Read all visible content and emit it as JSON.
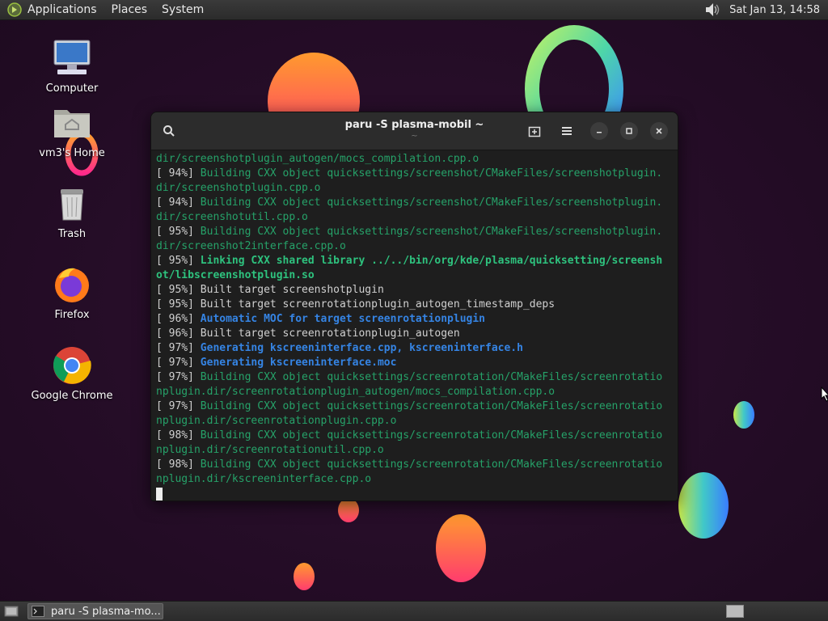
{
  "top_panel": {
    "menus": [
      "Applications",
      "Places",
      "System"
    ],
    "clock": "Sat Jan 13, 14:58"
  },
  "desktop_icons": [
    {
      "label": "Computer",
      "icon": "computer-icon"
    },
    {
      "label": "vm3's Home",
      "icon": "home-folder-icon"
    },
    {
      "label": "Trash",
      "icon": "trash-icon"
    },
    {
      "label": "Firefox",
      "icon": "firefox-icon"
    },
    {
      "label": "Google Chrome",
      "icon": "chrome-icon"
    }
  ],
  "terminal": {
    "title": "paru -S plasma-mobil ~",
    "subtitle": "~",
    "lines": [
      [
        {
          "t": "dir/screenshotplugin_autogen/mocs_compilation.cpp.o",
          "c": "green"
        }
      ],
      [
        {
          "t": "[ 94%] ",
          "c": "pct"
        },
        {
          "t": "Building CXX object quicksettings/screenshot/CMakeFiles/screenshotplugin.",
          "c": "green"
        }
      ],
      [
        {
          "t": "dir/screenshotplugin.cpp.o",
          "c": "green"
        }
      ],
      [
        {
          "t": "[ 94%] ",
          "c": "pct"
        },
        {
          "t": "Building CXX object quicksettings/screenshot/CMakeFiles/screenshotplugin.",
          "c": "green"
        }
      ],
      [
        {
          "t": "dir/screenshotutil.cpp.o",
          "c": "green"
        }
      ],
      [
        {
          "t": "[ 95%] ",
          "c": "pct"
        },
        {
          "t": "Building CXX object quicksettings/screenshot/CMakeFiles/screenshotplugin.",
          "c": "green"
        }
      ],
      [
        {
          "t": "dir/screenshot2interface.cpp.o",
          "c": "green"
        }
      ],
      [
        {
          "t": "[ 95%] ",
          "c": "pct"
        },
        {
          "t": "Linking CXX shared library ../../bin/org/kde/plasma/quicksetting/screensh",
          "c": "green-bold"
        }
      ],
      [
        {
          "t": "ot/libscreenshotplugin.so",
          "c": "green-bold"
        }
      ],
      [
        {
          "t": "[ 95%] ",
          "c": "pct"
        },
        {
          "t": "Built target screenshotplugin",
          "c": "plain"
        }
      ],
      [
        {
          "t": "[ 95%] ",
          "c": "pct"
        },
        {
          "t": "Built target screenrotationplugin_autogen_timestamp_deps",
          "c": "plain"
        }
      ],
      [
        {
          "t": "[ 96%] ",
          "c": "pct"
        },
        {
          "t": "Automatic MOC for target screenrotationplugin",
          "c": "blue-bold"
        }
      ],
      [
        {
          "t": "[ 96%] ",
          "c": "pct"
        },
        {
          "t": "Built target screenrotationplugin_autogen",
          "c": "plain"
        }
      ],
      [
        {
          "t": "[ 97%] ",
          "c": "pct"
        },
        {
          "t": "Generating kscreeninterface.cpp, kscreeninterface.h",
          "c": "blue-bold"
        }
      ],
      [
        {
          "t": "[ 97%] ",
          "c": "pct"
        },
        {
          "t": "Generating kscreeninterface.moc",
          "c": "blue-bold"
        }
      ],
      [
        {
          "t": "[ 97%] ",
          "c": "pct"
        },
        {
          "t": "Building CXX object quicksettings/screenrotation/CMakeFiles/screenrotatio",
          "c": "green"
        }
      ],
      [
        {
          "t": "nplugin.dir/screenrotationplugin_autogen/mocs_compilation.cpp.o",
          "c": "green"
        }
      ],
      [
        {
          "t": "[ 97%] ",
          "c": "pct"
        },
        {
          "t": "Building CXX object quicksettings/screenrotation/CMakeFiles/screenrotatio",
          "c": "green"
        }
      ],
      [
        {
          "t": "nplugin.dir/screenrotationplugin.cpp.o",
          "c": "green"
        }
      ],
      [
        {
          "t": "[ 98%] ",
          "c": "pct"
        },
        {
          "t": "Building CXX object quicksettings/screenrotation/CMakeFiles/screenrotatio",
          "c": "green"
        }
      ],
      [
        {
          "t": "nplugin.dir/screenrotationutil.cpp.o",
          "c": "green"
        }
      ],
      [
        {
          "t": "[ 98%] ",
          "c": "pct"
        },
        {
          "t": "Building CXX object quicksettings/screenrotation/CMakeFiles/screenrotatio",
          "c": "green"
        }
      ],
      [
        {
          "t": "nplugin.dir/kscreeninterface.cpp.o",
          "c": "green"
        }
      ]
    ]
  },
  "taskbar": {
    "window_button": "paru -S plasma-mo..."
  }
}
